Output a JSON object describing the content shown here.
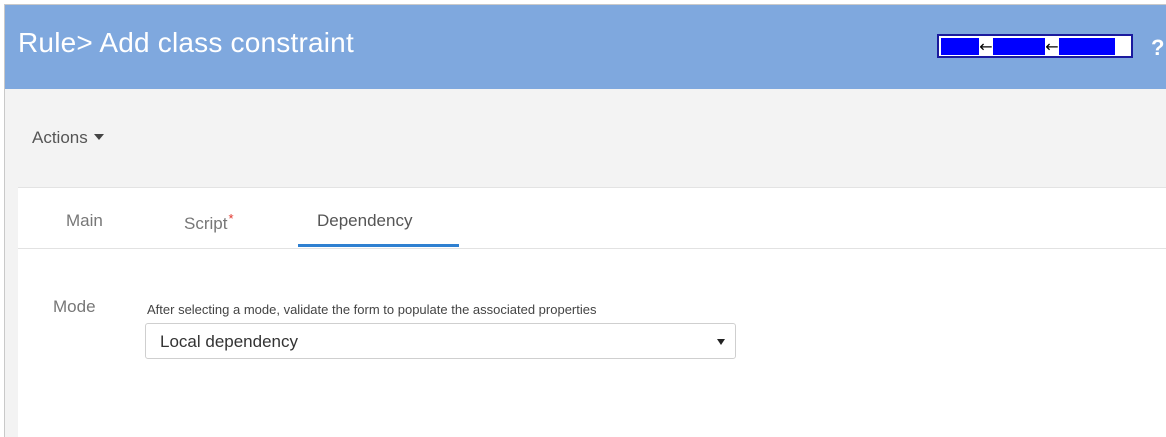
{
  "header": {
    "title": "Rule> Add class constraint",
    "nav_arrows": [
      "←",
      "←"
    ],
    "help_label": "?",
    "background_color": "#7fa8de",
    "nav_block_color": "#0000ff"
  },
  "toolbar": {
    "actions_label": "Actions"
  },
  "tabs": [
    {
      "label": "Main",
      "active": false
    },
    {
      "label": "Script",
      "required_marker": "*",
      "active": false
    },
    {
      "label": "Dependency",
      "active": true
    }
  ],
  "form": {
    "mode_label": "Mode",
    "mode_hint": "After selecting a mode, validate the form to populate the associated properties",
    "mode_value": "Local dependency"
  },
  "colors": {
    "active_tab_underline": "#2f80d1",
    "required_marker": "#e0342b"
  }
}
